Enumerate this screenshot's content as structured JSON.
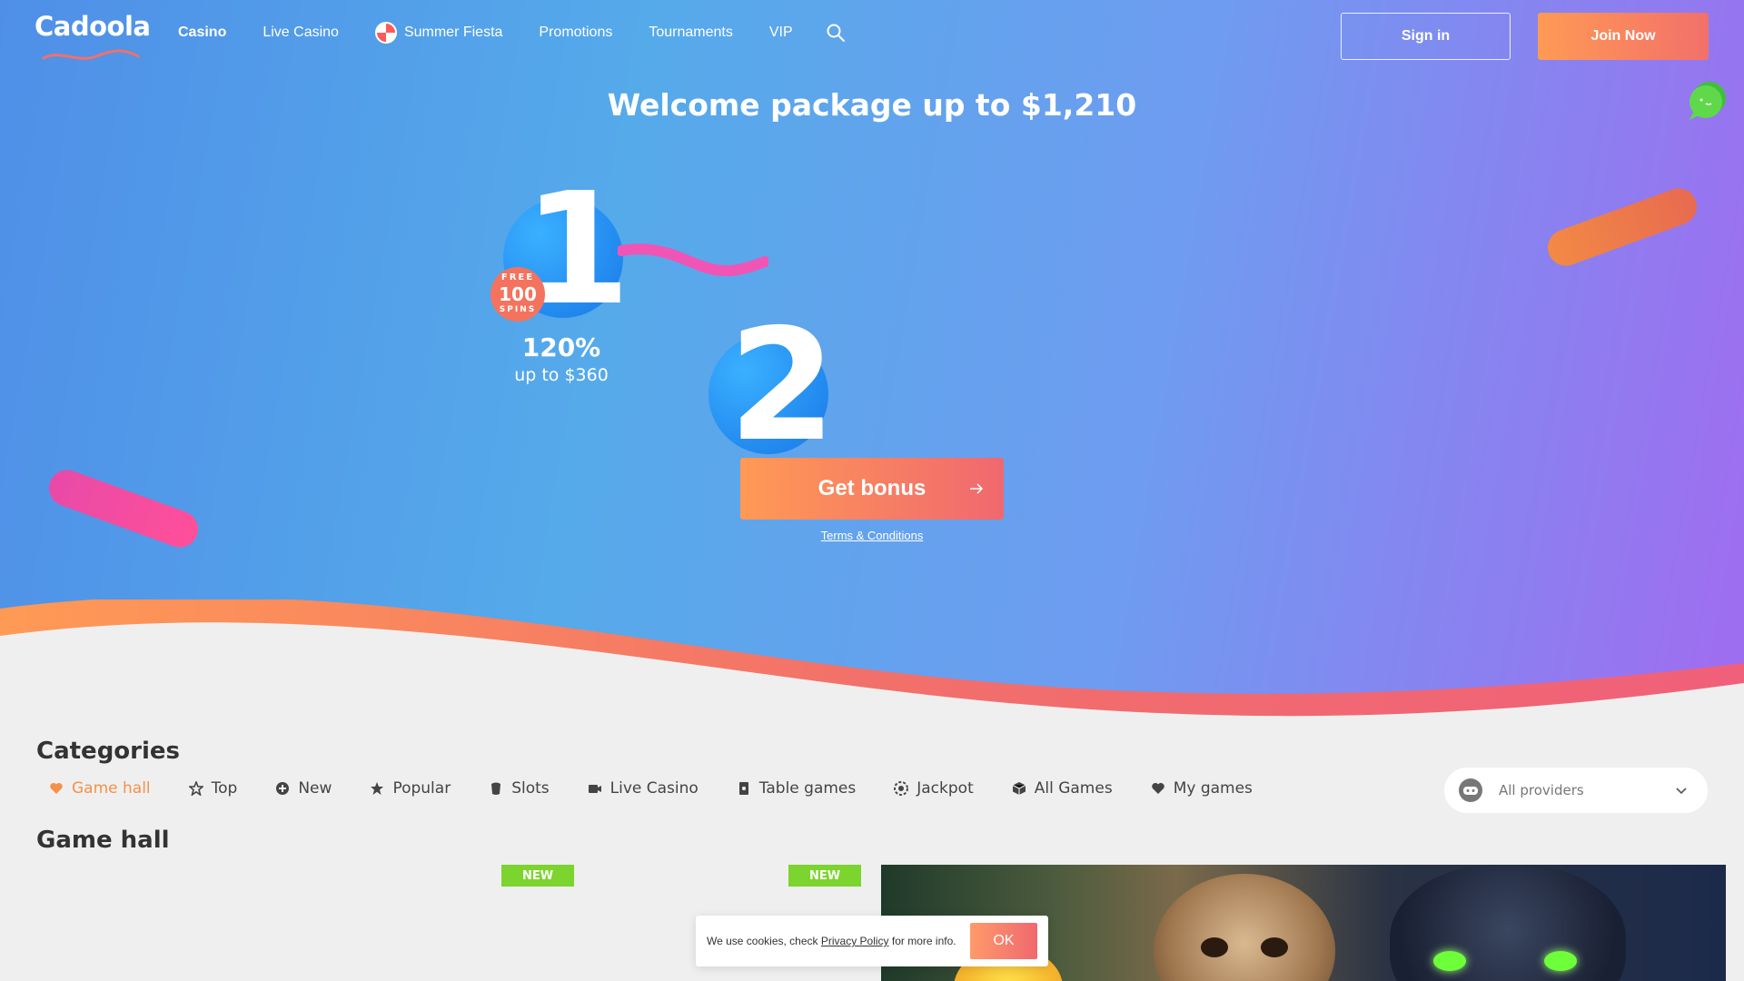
{
  "brand": {
    "name": "Cadoola"
  },
  "nav": {
    "items": [
      {
        "label": "Casino",
        "active": true
      },
      {
        "label": "Live Casino"
      },
      {
        "label": "Summer Fiesta",
        "icon": "beach-ball-icon"
      },
      {
        "label": "Promotions"
      },
      {
        "label": "Tournaments"
      },
      {
        "label": "VIP"
      }
    ],
    "search_icon": "search-icon"
  },
  "auth": {
    "signin_label": "Sign in",
    "join_label": "Join Now"
  },
  "hero": {
    "headline": "Welcome package up to $1,210",
    "step1": {
      "number": "1",
      "percent": "120%",
      "amount": "up to $360",
      "badge": {
        "top": "FREE",
        "count": "100",
        "bottom": "SPINS"
      }
    },
    "step2": {
      "number": "2"
    },
    "cta_label": "Get bonus",
    "terms_label": "Terms & Conditions"
  },
  "categories": {
    "title": "Categories",
    "items": [
      {
        "label": "Game hall",
        "icon": "heart-icon",
        "active": true
      },
      {
        "label": "Top",
        "icon": "star-outline-icon"
      },
      {
        "label": "New",
        "icon": "plus-circle-icon"
      },
      {
        "label": "Popular",
        "icon": "star-icon"
      },
      {
        "label": "Slots",
        "icon": "slots-icon"
      },
      {
        "label": "Live Casino",
        "icon": "video-camera-icon"
      },
      {
        "label": "Table games",
        "icon": "cards-icon"
      },
      {
        "label": "Jackpot",
        "icon": "chip-icon"
      },
      {
        "label": "All Games",
        "icon": "cube-icon"
      },
      {
        "label": "My games",
        "icon": "heart-icon"
      }
    ],
    "providers": {
      "label": "All providers",
      "icon": "gamepad-icon"
    }
  },
  "game_hall": {
    "title": "Game hall",
    "badges": [
      "NEW",
      "NEW"
    ]
  },
  "cookie": {
    "prefix": "We use cookies, check",
    "link": "Privacy Policy",
    "suffix": "for more info.",
    "ok_label": "OK"
  },
  "colors": {
    "accent_orange": "#f5914a",
    "new_badge": "#7cd42e",
    "hero_blue": "#55aaea",
    "hero_purple": "#a06cf0"
  }
}
